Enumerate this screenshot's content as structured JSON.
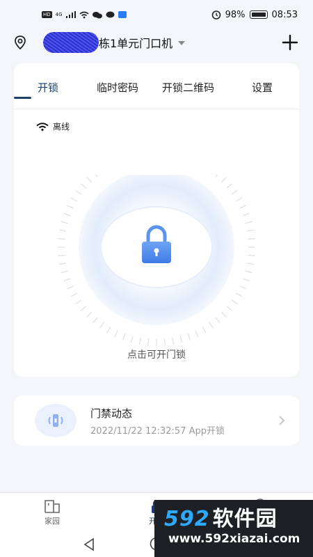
{
  "status_bar": {
    "hd": "HD",
    "network": "4G",
    "battery_percent": "98%",
    "time": "08:53"
  },
  "header": {
    "device_name": "栋1单元门口机"
  },
  "tabs": [
    {
      "label": "开锁",
      "active": true
    },
    {
      "label": "临时密码",
      "active": false
    },
    {
      "label": "开锁二维码",
      "active": false
    },
    {
      "label": "设置",
      "active": false
    }
  ],
  "device_status": "离线",
  "unlock_hint": "点击可开门锁",
  "activity": {
    "title": "门禁动态",
    "detail": "2022/11/22 12:32:57 App开锁"
  },
  "bottom_nav": [
    {
      "label": "家园",
      "icon": "home-icon",
      "active": false
    },
    {
      "label": "开锁",
      "icon": "lock-icon",
      "active": true
    }
  ],
  "watermark": {
    "logo_num": "592",
    "logo_text": "软件园",
    "url": "www.592xiazai.com"
  },
  "colors": {
    "accent": "#1e3f6e",
    "background": "#f3f5f8",
    "lock_blue": "#4f8ef0"
  }
}
